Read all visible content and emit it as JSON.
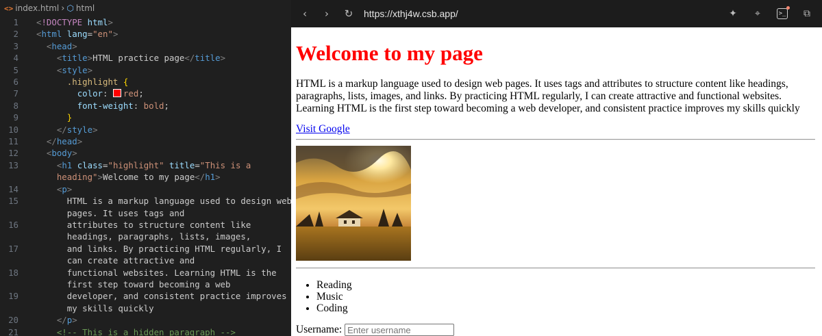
{
  "breadcrumb": {
    "file": "index.html",
    "symbol": "html"
  },
  "browser": {
    "url": "https://xthj4w.csb.app/"
  },
  "page": {
    "heading": "Welcome to my page",
    "paragraph": "HTML is a markup language used to design web pages. It uses tags and attributes to structure content like headings, paragraphs, lists, images, and links. By practicing HTML regularly, I can create attractive and functional websites. Learning HTML is the first step toward becoming a web developer, and consistent practice improves my skills quickly",
    "link_text": "Visit Google",
    "list_items": [
      "Reading",
      "Music",
      "Coding"
    ],
    "username_label": "Username:",
    "username_placeholder": "Enter username"
  },
  "editor": {
    "line_numbers": [
      "1",
      "2",
      "3",
      "4",
      "5",
      "6",
      "7",
      "8",
      "9",
      "10",
      "11",
      "12",
      "13",
      "",
      "14",
      "15",
      "",
      "16",
      "",
      "17",
      "",
      "18",
      "",
      "19",
      "",
      "20",
      "21"
    ]
  },
  "colors": {
    "heading": "#ff0000",
    "editor_bg": "#1f1f1f",
    "toolbar_bg": "#1c1c1c",
    "link": "#0000ee"
  }
}
